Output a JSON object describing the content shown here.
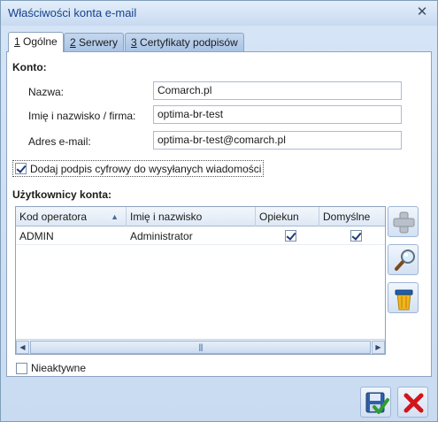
{
  "window": {
    "title": "Właściwości konta e-mail"
  },
  "tabs": [
    {
      "key": "1",
      "label": " Ogólne"
    },
    {
      "key": "2",
      "label": " Serwery"
    },
    {
      "key": "3",
      "label": " Certyfikaty podpisów"
    }
  ],
  "konto": {
    "heading": "Konto:",
    "nazwa_label": "Nazwa:",
    "nazwa_value": "Comarch.pl",
    "imie_label": "Imię i nazwisko / firma:",
    "imie_value": "optima-br-test",
    "adres_label": "Adres e-mail:",
    "adres_value": "optima-br-test@comarch.pl"
  },
  "signature": {
    "label": "Dodaj podpis cyfrowy do wysyłanych wiadomości",
    "checked": true
  },
  "users": {
    "heading": "Użytkownicy konta:",
    "columns": [
      "Kod operatora",
      "Imię i nazwisko",
      "Opiekun",
      "Domyślne"
    ],
    "rows": [
      {
        "kod": "ADMIN",
        "imie": "Administrator",
        "opiekun": true,
        "domyslne": true
      }
    ]
  },
  "inactive": {
    "label": "Nieaktywne",
    "checked": false
  },
  "icons": {
    "close": "close-icon",
    "add": "plus-icon",
    "preview": "magnifier-icon",
    "delete": "trash-icon",
    "save": "save-icon",
    "cancel": "cancel-icon"
  },
  "colors": {
    "title_text": "#15428b",
    "accent_red": "#d4141b",
    "accent_green": "#2e9e2e"
  }
}
